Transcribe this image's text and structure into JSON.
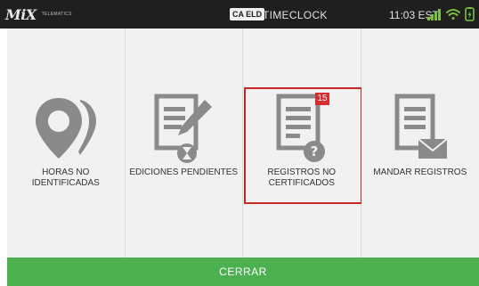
{
  "status_bar": {
    "logo_text": "MiX",
    "logo_subtitle": "TELEMATICS",
    "eld_badge": "CA ELD",
    "app_title": "TIMECLOCK",
    "time": "11:03 EST",
    "icons": [
      "signal-icon",
      "wifi-icon",
      "battery-icon"
    ]
  },
  "tiles": [
    {
      "label": "HORAS NO IDENTIFICADAS",
      "icon": "location-person-icon",
      "badge": null,
      "selected": false
    },
    {
      "label": "EDICIONES PENDIENTES",
      "icon": "document-edit-hourglass-icon",
      "badge": null,
      "selected": false
    },
    {
      "label": "REGISTROS NO CERTIFICADOS",
      "icon": "document-question-icon",
      "badge": "15",
      "selected": true
    },
    {
      "label": "MANDAR REGISTROS",
      "icon": "document-mail-icon",
      "badge": null,
      "selected": false
    }
  ],
  "footer": {
    "close_label": "CERRAR"
  },
  "colors": {
    "status_bar_bg": "#1f1f1f",
    "tile_bg": "#f1f1f1",
    "icon_gray": "#8a8a8a",
    "selection_border": "#c62828",
    "badge_bg": "#d32f2f",
    "footer_bg": "#4caf50"
  }
}
